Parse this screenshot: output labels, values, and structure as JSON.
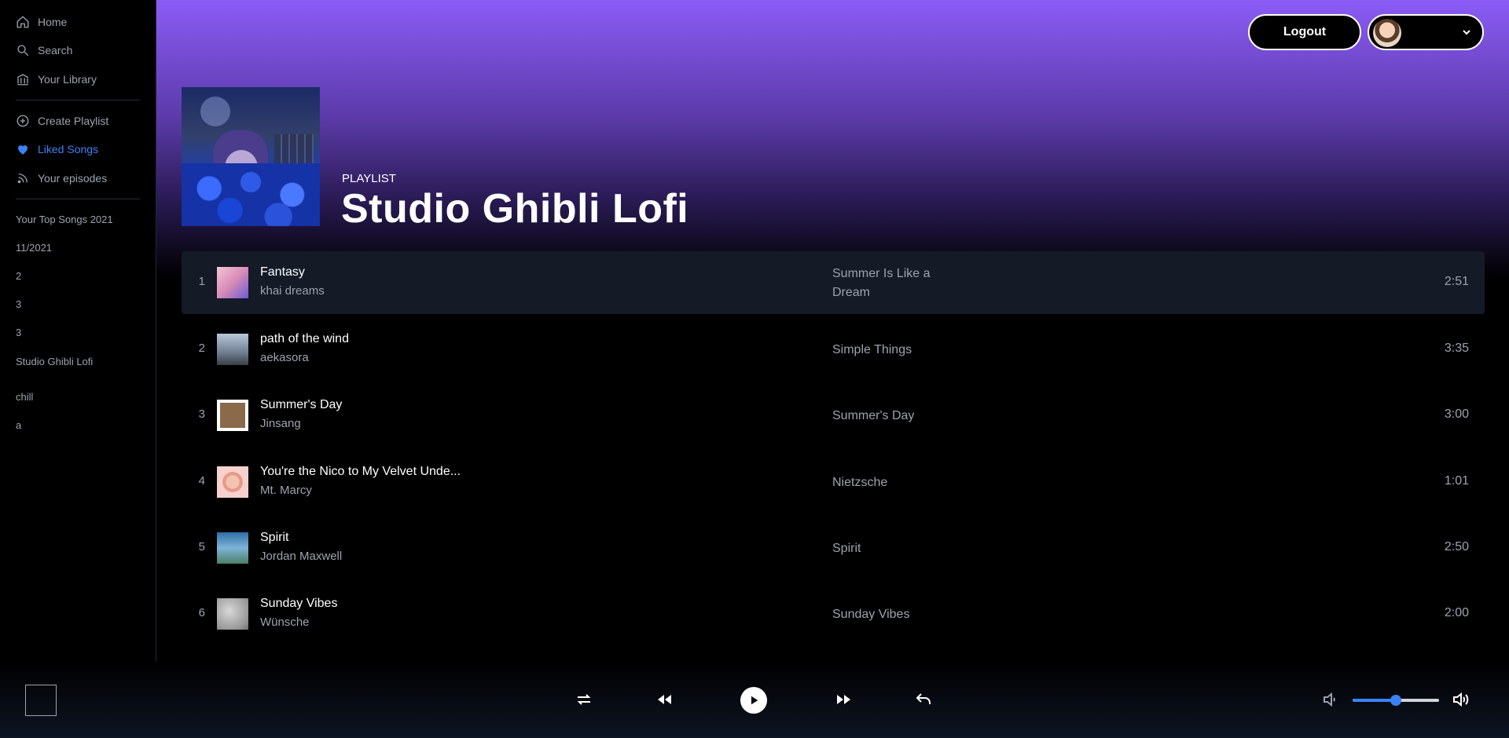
{
  "sidebar": {
    "nav": [
      {
        "label": "Home",
        "icon": "home-icon"
      },
      {
        "label": "Search",
        "icon": "search-icon"
      },
      {
        "label": "Your Library",
        "icon": "library-icon"
      }
    ],
    "actions": [
      {
        "label": "Create Playlist",
        "icon": "plus-circle-icon"
      },
      {
        "label": "Liked Songs",
        "icon": "heart-icon",
        "active": true
      },
      {
        "label": "Your episodes",
        "icon": "rss-icon"
      }
    ],
    "playlists": [
      "Your Top Songs 2021",
      "11/2021",
      "2",
      "3",
      "3",
      "Studio Ghibli Lofi",
      "chill",
      "a"
    ]
  },
  "header": {
    "logout_label": "Logout"
  },
  "playlist": {
    "type_label": "PLAYLIST",
    "title": "Studio Ghibli Lofi",
    "tracks": [
      {
        "num": "1",
        "name": "Fantasy",
        "artist": "khai dreams",
        "album": "Summer Is Like a Dream",
        "duration": "2:51"
      },
      {
        "num": "2",
        "name": "path of the wind",
        "artist": "aekasora",
        "album": "Simple Things",
        "duration": "3:35"
      },
      {
        "num": "3",
        "name": "Summer's Day",
        "artist": "Jinsang",
        "album": "Summer's Day",
        "duration": "3:00"
      },
      {
        "num": "4",
        "name": "You're the Nico to My Velvet Unde...",
        "artist": "Mt. Marcy",
        "album": "Nietzsche",
        "duration": "1:01"
      },
      {
        "num": "5",
        "name": "Spirit",
        "artist": "Jordan Maxwell",
        "album": "Spirit",
        "duration": "2:50"
      },
      {
        "num": "6",
        "name": "Sunday Vibes",
        "artist": "Wünsche",
        "album": "Sunday Vibes",
        "duration": "2:00"
      }
    ]
  },
  "player": {
    "volume": 0.5
  },
  "colors": {
    "accent": "#3b82f6",
    "gradient_top": "#8b5cf6"
  }
}
